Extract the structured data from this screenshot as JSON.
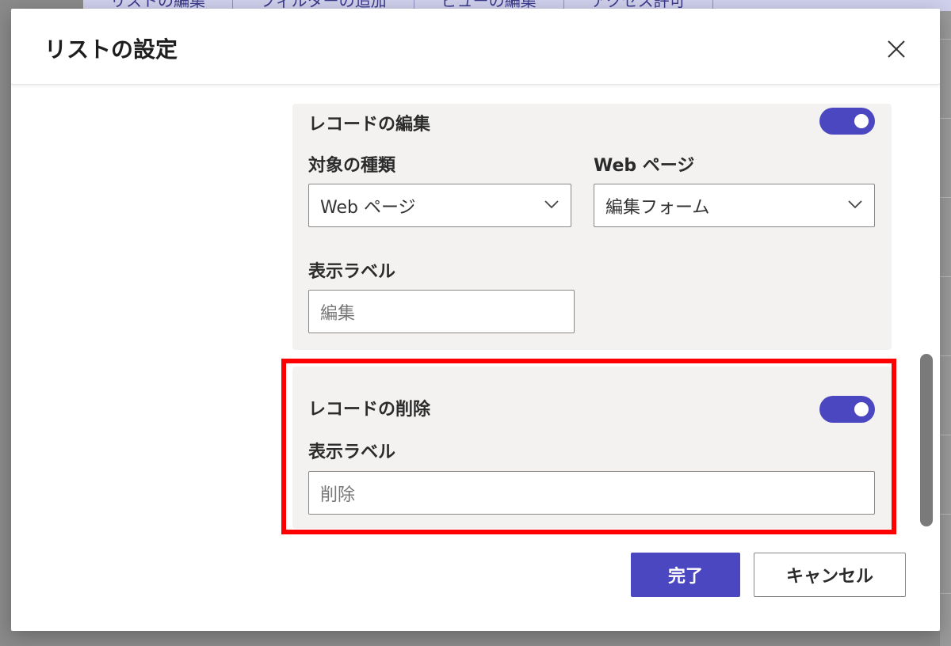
{
  "background": {
    "toolbar_items": [
      "リストの編集",
      "フィルターの追加",
      "ビューの編集",
      "アクセス許可"
    ]
  },
  "dialog": {
    "title": "リストの設定",
    "close_icon": "close-icon"
  },
  "edit_section": {
    "title": "レコードの編集",
    "enabled": true,
    "target_type_label": "対象の種類",
    "target_type_value": "Web ページ",
    "web_page_label": "Web ページ",
    "web_page_value": "編集フォーム",
    "display_label_label": "表示ラベル",
    "display_label_value": "編集"
  },
  "delete_section": {
    "title": "レコードの削除",
    "enabled": true,
    "display_label_label": "表示ラベル",
    "display_label_value": "削除"
  },
  "footer": {
    "done_label": "完了",
    "cancel_label": "キャンセル"
  },
  "colors": {
    "accent": "#4b47c1",
    "highlight": "#ff0000",
    "card_bg": "#f3f2f1"
  }
}
